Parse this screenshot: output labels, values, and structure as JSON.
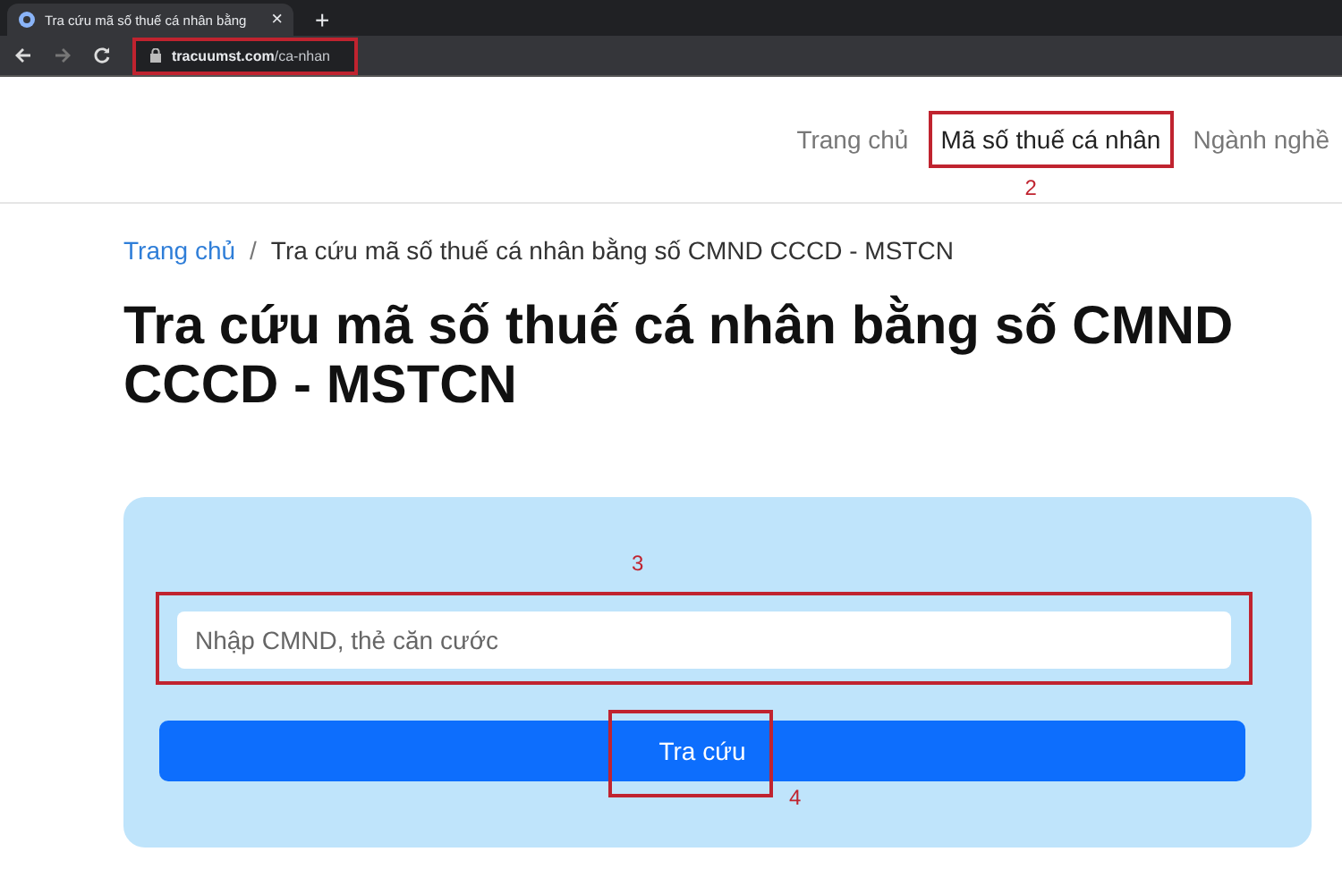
{
  "browser": {
    "tab_title": "Tra cứu mã số thuế cá nhân bằng",
    "tab_close": "×",
    "new_tab": "+",
    "url_domain": "tracuumst.com",
    "url_path": "/ca-nhan"
  },
  "nav": [
    {
      "label": "Trang chủ",
      "selected": false
    },
    {
      "label": "Mã số thuế cá nhân",
      "selected": true,
      "annotation": "2"
    },
    {
      "label": "Ngành nghề",
      "selected": false
    }
  ],
  "breadcrumb": {
    "link": "Trang chủ",
    "separator": "/",
    "current": "Tra cứu mã số thuế cá nhân bằng số CMND CCCD - MSTCN"
  },
  "heading": "Tra cứu mã số thuế cá nhân bằng số CMND CCCD - MSTCN",
  "form": {
    "input_annotation": "3",
    "placeholder": "Nhập CMND, thẻ căn cước",
    "button": "Tra cứu",
    "button_annotation": "4"
  }
}
